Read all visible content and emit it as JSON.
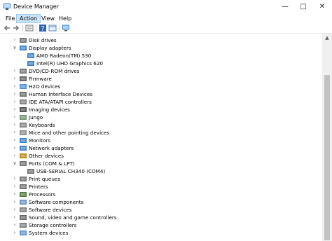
{
  "window": {
    "title": "Device Manager"
  },
  "menu": [
    "File",
    "Action",
    "View",
    "Help"
  ],
  "toolbar": [
    "back-icon",
    "forward-icon",
    "properties-icon",
    "help-icon",
    "show-hidden-icon",
    "monitor-icon"
  ],
  "tree": {
    "rows": [
      {
        "label": "Disk drives",
        "level": 1,
        "expanded": false,
        "icon": "disk-drive-icon"
      },
      {
        "label": "Display adapters",
        "level": 1,
        "expanded": true,
        "icon": "display-adapter-icon"
      },
      {
        "label": "AMD Radeon(TM) 530",
        "level": 2,
        "icon": "display-adapter-icon"
      },
      {
        "label": "Intel(R) UHD Graphics 620",
        "level": 2,
        "icon": "display-adapter-icon"
      },
      {
        "label": "DVD/CD-ROM drives",
        "level": 1,
        "expanded": false,
        "icon": "dvd-drive-icon"
      },
      {
        "label": "Firmware",
        "level": 1,
        "expanded": false,
        "icon": "firmware-icon"
      },
      {
        "label": "H2O devices",
        "level": 1,
        "expanded": false,
        "icon": "h2o-device-icon"
      },
      {
        "label": "Human Interface Devices",
        "level": 1,
        "expanded": false,
        "icon": "hid-icon"
      },
      {
        "label": "IDE ATA/ATAPI controllers",
        "level": 1,
        "expanded": false,
        "icon": "ide-controller-icon"
      },
      {
        "label": "Imaging devices",
        "level": 1,
        "expanded": false,
        "icon": "camera-icon"
      },
      {
        "label": "Jungo",
        "level": 1,
        "expanded": false,
        "icon": "jungo-icon"
      },
      {
        "label": "Keyboards",
        "level": 1,
        "expanded": false,
        "icon": "keyboard-icon"
      },
      {
        "label": "Mice and other pointing devices",
        "level": 1,
        "expanded": false,
        "icon": "mouse-icon"
      },
      {
        "label": "Monitors",
        "level": 1,
        "expanded": false,
        "icon": "monitor-icon"
      },
      {
        "label": "Network adapters",
        "level": 1,
        "expanded": false,
        "icon": "network-adapter-icon"
      },
      {
        "label": "Other devices",
        "level": 1,
        "expanded": false,
        "icon": "unknown-device-icon"
      },
      {
        "label": "Ports (COM & LPT)",
        "level": 1,
        "expanded": true,
        "icon": "port-icon"
      },
      {
        "label": "USB-SERIAL CH340 (COM4)",
        "level": 2,
        "icon": "port-icon"
      },
      {
        "label": "Print queues",
        "level": 1,
        "expanded": false,
        "icon": "printer-icon"
      },
      {
        "label": "Printers",
        "level": 1,
        "expanded": false,
        "icon": "printer-icon"
      },
      {
        "label": "Processors",
        "level": 1,
        "expanded": false,
        "icon": "processor-icon"
      },
      {
        "label": "Software components",
        "level": 1,
        "expanded": false,
        "icon": "software-component-icon"
      },
      {
        "label": "Software devices",
        "level": 1,
        "expanded": false,
        "icon": "software-device-icon"
      },
      {
        "label": "Sound, video and game controllers",
        "level": 1,
        "expanded": false,
        "icon": "speaker-icon"
      },
      {
        "label": "Storage controllers",
        "level": 1,
        "expanded": false,
        "icon": "storage-controller-icon"
      },
      {
        "label": "System devices",
        "level": 1,
        "expanded": false,
        "icon": "system-device-icon"
      }
    ]
  },
  "colors": {
    "menu_active_bg": "#cce4f7",
    "icon_blue": "#3a7fc6",
    "scrollbar_thumb": "#c2c2c2"
  }
}
